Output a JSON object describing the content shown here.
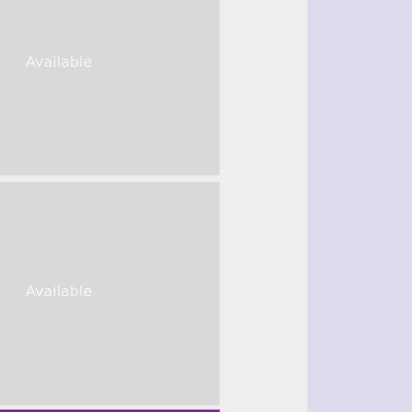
{
  "tiles": [
    {
      "label": "Available"
    },
    {
      "label": "Available"
    }
  ],
  "colors": {
    "background": "#eeeeee",
    "tile": "#d9d9d9",
    "tile_text": "#f7f7f7",
    "right_panel": "#dcdcec",
    "accent": "#7b1fa2"
  }
}
